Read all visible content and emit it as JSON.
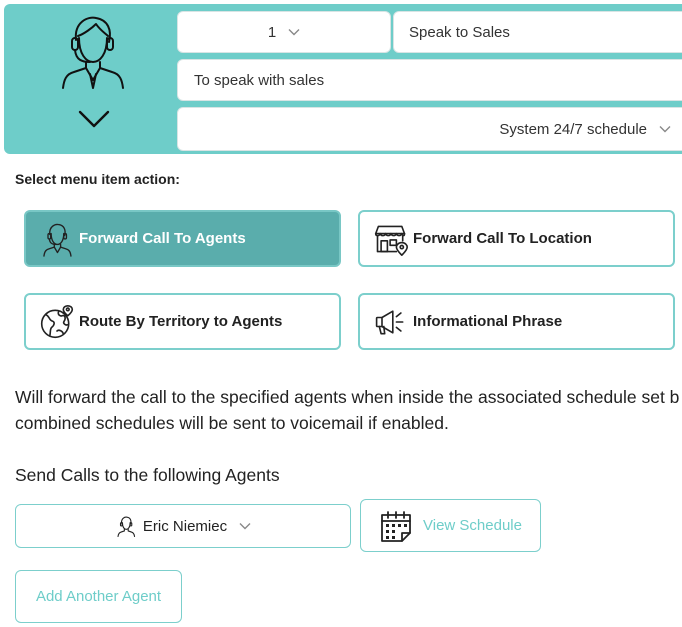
{
  "header": {
    "avatar_icon": "agent-headset-icon",
    "collapse_icon": "chevron-down-icon",
    "menu_number": "1",
    "menu_name": "Speak to Sales",
    "phrase": "To speak with sales",
    "schedule": "System 24/7 schedule"
  },
  "actions": {
    "label": "Select menu item action:",
    "items": [
      {
        "label": "Forward Call To Agents",
        "icon": "agent-headset-icon",
        "selected": true
      },
      {
        "label": "Forward Call To Location",
        "icon": "storefront-location-icon",
        "selected": false
      },
      {
        "label": "Route By Territory to Agents",
        "icon": "globe-location-icon",
        "selected": false
      },
      {
        "label": "Informational Phrase",
        "icon": "megaphone-icon",
        "selected": false
      }
    ]
  },
  "description": {
    "line1": "Will forward the call to the specified agents when inside the associated schedule set b",
    "line2": "combined schedules will be sent to voicemail if enabled."
  },
  "agents": {
    "label": "Send Calls to the following Agents",
    "selected_agent": "Eric Niemiec",
    "view_schedule": "View Schedule",
    "add_agent": "Add Another Agent"
  },
  "colors": {
    "teal": "#6ecdc9",
    "teal_dark": "#5aadac",
    "border": "#7ccfcc"
  }
}
